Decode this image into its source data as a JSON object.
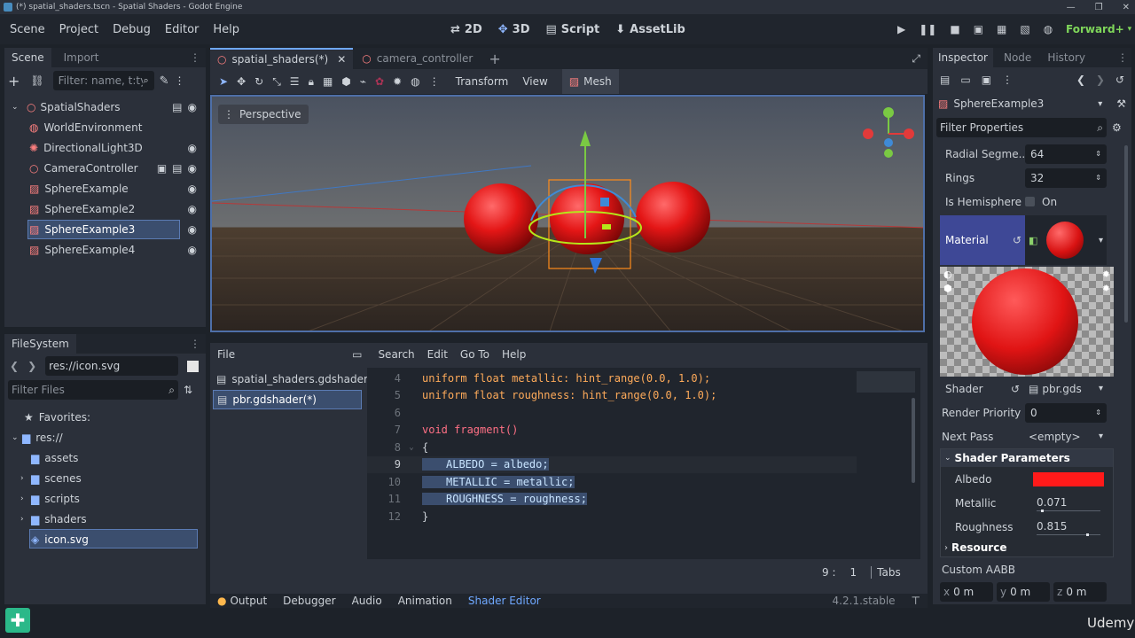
{
  "window": {
    "title": "(*) spatial_shaders.tscn - Spatial Shaders - Godot Engine"
  },
  "menu": {
    "items": [
      "Scene",
      "Project",
      "Debug",
      "Editor",
      "Help"
    ]
  },
  "workspaces": {
    "d2": "2D",
    "d3": "3D",
    "script": "Script",
    "assetlib": "AssetLib"
  },
  "renderer": "Forward+",
  "scene_dock": {
    "tab_scene": "Scene",
    "tab_import": "Import",
    "filter_placeholder": "Filter: name, t:ty",
    "nodes": [
      {
        "label": "SpatialShaders"
      },
      {
        "label": "WorldEnvironment"
      },
      {
        "label": "DirectionalLight3D"
      },
      {
        "label": "CameraController"
      },
      {
        "label": "SphereExample"
      },
      {
        "label": "SphereExample2"
      },
      {
        "label": "SphereExample3"
      },
      {
        "label": "SphereExample4"
      }
    ]
  },
  "filesystem": {
    "title": "FileSystem",
    "path": "res://icon.svg",
    "filter_placeholder": "Filter Files",
    "favorites": "Favorites:",
    "root": "res://",
    "folders": [
      "assets",
      "scenes",
      "scripts",
      "shaders"
    ],
    "selected_file": "icon.svg"
  },
  "editor_tabs": {
    "tab1": "spatial_shaders(*)",
    "tab2": "camera_controller"
  },
  "viewport_toolbar": {
    "transform": "Transform",
    "view": "View",
    "mesh": "Mesh"
  },
  "viewport": {
    "label": "Perspective"
  },
  "script_editor": {
    "menu": [
      "File",
      "Search",
      "Edit",
      "Go To",
      "Help"
    ],
    "files": [
      "spatial_shaders.gdshader",
      "pbr.gdshader(*)"
    ],
    "status_line": "9 :",
    "status_col": "1",
    "status_indent": "Tabs",
    "code": [
      {
        "n": "4",
        "text": "uniform float metallic: hint_range(0.0, 1.0);"
      },
      {
        "n": "5",
        "text": "uniform float roughness: hint_range(0.0, 1.0);"
      },
      {
        "n": "6",
        "text": ""
      },
      {
        "n": "7",
        "text": "void fragment()"
      },
      {
        "n": "8",
        "text": "{"
      },
      {
        "n": "9",
        "text": "ALBEDO = albedo;"
      },
      {
        "n": "10",
        "text": "METALLIC = metallic;"
      },
      {
        "n": "11",
        "text": "ROUGHNESS = roughness;"
      },
      {
        "n": "12",
        "text": "}"
      }
    ]
  },
  "bottom_panel": {
    "tabs": [
      "Output",
      "Debugger",
      "Audio",
      "Animation",
      "Shader Editor"
    ],
    "version": "4.2.1.stable"
  },
  "inspector": {
    "tabs": {
      "inspector": "Inspector",
      "node": "Node",
      "history": "History"
    },
    "object": "SphereExample3",
    "filter_placeholder": "Filter Properties",
    "radial_label": "Radial Segme...",
    "radial_value": "64",
    "rings_label": "Rings",
    "rings_value": "32",
    "hemisphere_label": "Is Hemisphere",
    "hemisphere_value": "On",
    "material_label": "Material",
    "shader_label": "Shader",
    "shader_value": "pbr.gds",
    "render_priority_label": "Render Priority",
    "render_priority_value": "0",
    "next_pass_label": "Next Pass",
    "next_pass_value": "<empty>",
    "shader_params_label": "Shader Parameters",
    "albedo_label": "Albedo",
    "albedo_color": "#ff1a1a",
    "metallic_label": "Metallic",
    "metallic_value": "0.071",
    "roughness_label": "Roughness",
    "roughness_value": "0.815",
    "resource_label": "Resource",
    "custom_aabb_label": "Custom AABB",
    "aabb": {
      "x_label": "x",
      "x_value": "0 m",
      "y_label": "y",
      "y_value": "0 m",
      "z_label": "z",
      "z_value": "0 m"
    }
  },
  "watermark": "Udemy"
}
